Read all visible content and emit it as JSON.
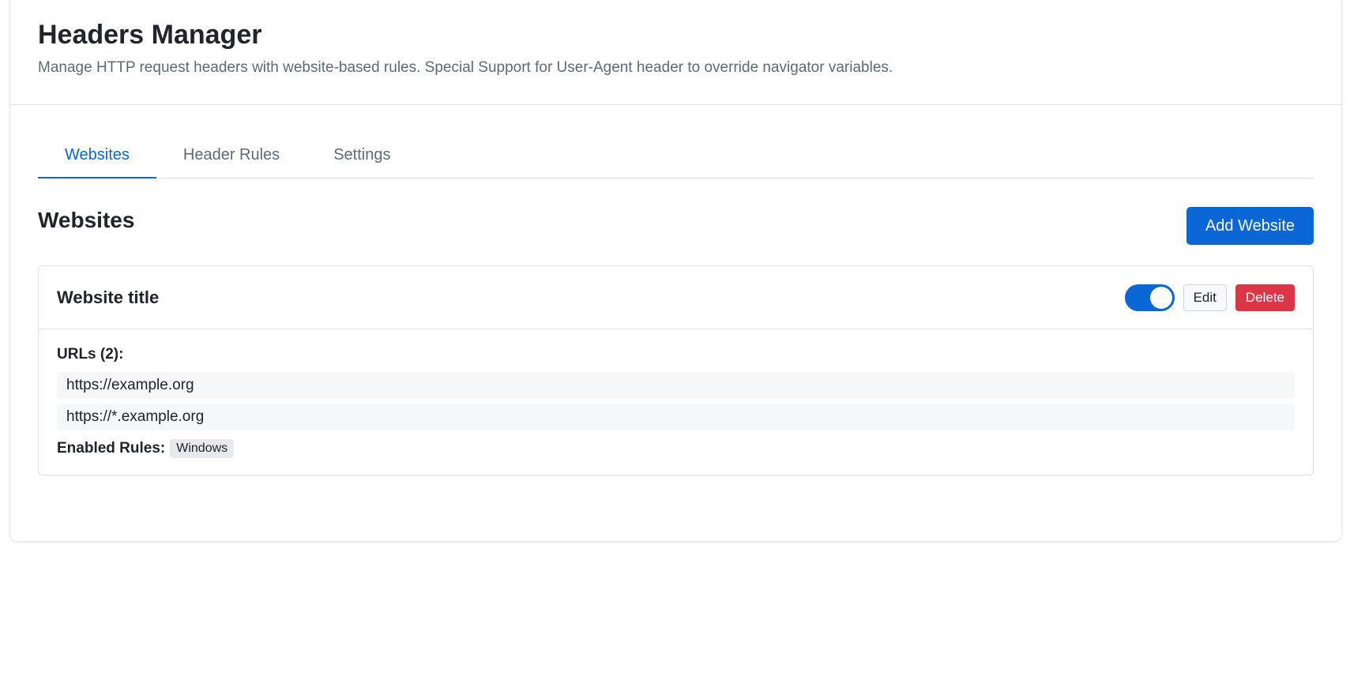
{
  "header": {
    "title": "Headers Manager",
    "subtitle": "Manage HTTP request headers with website-based rules. Special Support for User-Agent header to override navigator variables."
  },
  "tabs": [
    {
      "label": "Websites",
      "active": true
    },
    {
      "label": "Header Rules",
      "active": false
    },
    {
      "label": "Settings",
      "active": false
    }
  ],
  "section": {
    "title": "Websites",
    "add_button_label": "Add Website"
  },
  "website": {
    "title": "Website title",
    "enabled": true,
    "edit_label": "Edit",
    "delete_label": "Delete",
    "urls_label": "URLs (2):",
    "urls": [
      "https://example.org",
      "https://*.example.org"
    ],
    "enabled_rules_label": "Enabled Rules:",
    "rules": [
      "Windows"
    ]
  },
  "colors": {
    "accent": "#0b66d6",
    "danger": "#dc3545"
  }
}
